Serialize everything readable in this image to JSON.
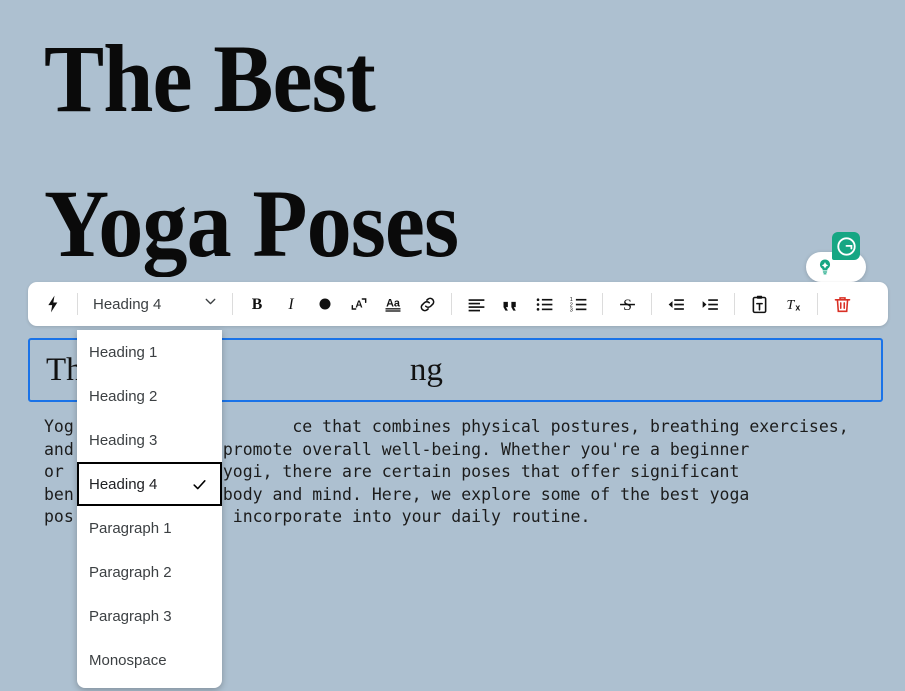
{
  "page": {
    "background_color": "#adc0d0",
    "headline": "The Best\nYoga Poses"
  },
  "grammarly": {
    "badge_icon": "grammarly-g-icon",
    "badge_color": "#15a683",
    "suggestion_icon": "lightbulb-icon",
    "suggestion_icon_color": "#15a683"
  },
  "toolbar": {
    "lightning_icon": "lightning-bolt-icon",
    "style_select": {
      "value": "Heading 4",
      "chevron_icon": "chevron-down-icon"
    },
    "buttons": [
      {
        "name": "bold-button",
        "icon": "bold-icon",
        "label": "B"
      },
      {
        "name": "italic-button",
        "icon": "italic-icon",
        "label": "I"
      },
      {
        "name": "text-color-button",
        "icon": "filled-circle-icon",
        "label": ""
      },
      {
        "name": "font-size-button",
        "icon": "font-size-a-icon",
        "label": ""
      },
      {
        "name": "text-highlight-button",
        "icon": "aa-underline-icon",
        "label": "Aa"
      },
      {
        "name": "link-button",
        "icon": "link-chain-icon",
        "label": ""
      },
      {
        "name": "align-left-button",
        "icon": "align-left-icon",
        "label": ""
      },
      {
        "name": "blockquote-button",
        "icon": "quote-marks-icon",
        "label": ""
      },
      {
        "name": "bulleted-list-button",
        "icon": "bulleted-list-icon",
        "label": ""
      },
      {
        "name": "numbered-list-button",
        "icon": "numbered-list-icon",
        "label": ""
      },
      {
        "name": "strikethrough-button",
        "icon": "strikethrough-icon",
        "label": "S"
      },
      {
        "name": "outdent-button",
        "icon": "outdent-icon",
        "label": ""
      },
      {
        "name": "indent-button",
        "icon": "indent-icon",
        "label": ""
      },
      {
        "name": "paste-as-text-button",
        "icon": "clipboard-text-icon",
        "label": ""
      },
      {
        "name": "clear-formatting-button",
        "icon": "clear-formatting-tx-icon",
        "label": "Tx"
      },
      {
        "name": "delete-button",
        "icon": "trash-icon",
        "label": "",
        "color": "#d93025"
      }
    ]
  },
  "editor": {
    "heading_field": {
      "visible_text_start": "Th",
      "visible_text_end": "ng",
      "border_color": "#1a73e8"
    },
    "body_paragraph_segments": {
      "line1_start": "Yog",
      "line1_rest": "ce that combines physical postures, breathing exercises,",
      "line2_start": "and",
      "line2_rest": "o promote overall well-being. Whether you're a beginner",
      "line3_start": "or",
      "line3_rest": "d yogi, there are certain poses that offer significant",
      "line4_start": "ben",
      "line4_rest": "r body and mind. Here, we explore some of the best yoga",
      "line5_start": "pos",
      "line5_rest": "an incorporate into your daily routine."
    }
  },
  "dropdown": {
    "items": [
      {
        "label": "Heading 1",
        "selected": false
      },
      {
        "label": "Heading 2",
        "selected": false
      },
      {
        "label": "Heading 3",
        "selected": false
      },
      {
        "label": "Heading 4",
        "selected": true
      },
      {
        "label": "Paragraph 1",
        "selected": false
      },
      {
        "label": "Paragraph 2",
        "selected": false
      },
      {
        "label": "Paragraph 3",
        "selected": false
      },
      {
        "label": "Monospace",
        "selected": false
      }
    ],
    "check_icon": "checkmark-icon"
  }
}
